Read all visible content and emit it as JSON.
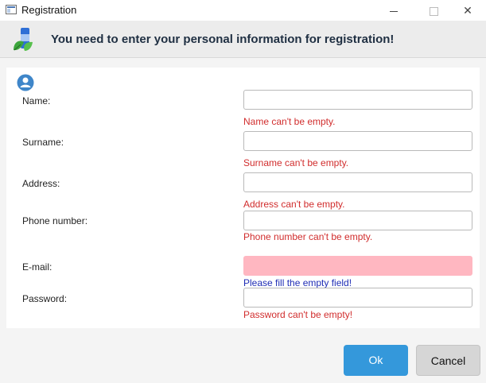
{
  "window": {
    "title": "Registration"
  },
  "header": {
    "message": "You  need to enter your personal information for registration!"
  },
  "form": {
    "fields": [
      {
        "label": "Name:",
        "value": "",
        "message": "Name can't be empty."
      },
      {
        "label": "Surname:",
        "value": "",
        "message": "Surname can't be empty."
      },
      {
        "label": "Address:",
        "value": "",
        "message": "Address can't be empty."
      },
      {
        "label": "Phone number:",
        "value": "",
        "message": "Phone number can't be empty."
      },
      {
        "label": "E-mail:",
        "value": "",
        "message": "Please fill the empty field!"
      },
      {
        "label": "Password:",
        "value": "",
        "message": "Password can't be empty!"
      }
    ]
  },
  "buttons": {
    "ok": "Ok",
    "cancel": "Cancel"
  },
  "colors": {
    "error": "#d12d2d",
    "warning_text": "#1f2db5",
    "invalid_field": "#ffb7c1",
    "primary": "#3498db"
  },
  "icons": {
    "app": "window-icon",
    "header": "registration-logo-icon",
    "user": "user-icon"
  }
}
